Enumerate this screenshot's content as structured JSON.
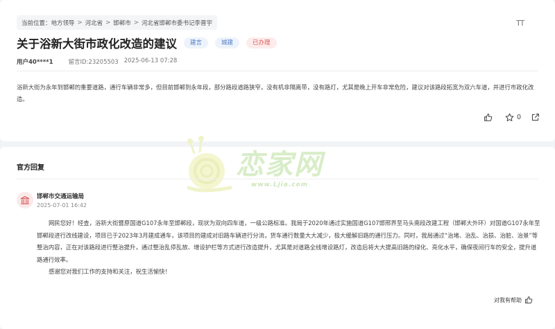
{
  "breadcrumb": {
    "prefix": "当前位置：",
    "items": [
      "地方领导",
      "河北省",
      "邯郸市",
      "河北省邯郸市委书记李晋宇"
    ],
    "separator": ">"
  },
  "font_size_label": "TT",
  "message": {
    "title": "关于浴新大街市政化改造的建议",
    "tags": [
      {
        "label": "建言",
        "color": "#4d7bc4"
      },
      {
        "label": "城建",
        "color": "#4d7bc4"
      },
      {
        "label": "已办理",
        "color": "#e05a5a"
      }
    ],
    "user": "用户40****1",
    "id_text": "留言ID:23205503",
    "datetime": "2025-06-13 07:28",
    "content": "浴新大街为永年到邯郸的重要道路，通行车辆非常多，但目前邯郸到永年段，部分路段道路狭窄，没有机非隔离带，没有路灯，尤其是晚上开车非常危险，建议对该路段拓宽为双六车道，并进行市政化改造。",
    "favorite_count": "0"
  },
  "icons": {
    "like": "thumbs-up-icon",
    "favorite": "star-icon",
    "share": "share-icon",
    "org": "government-building-icon"
  },
  "reply": {
    "section_title": "官方回复",
    "org": "邯郸市交通运输局",
    "datetime": "2025-07-01 16:42",
    "paragraph1": "网民您好！经查，浴新大街暨原国道G107永年至邯郸段，现状为双向四车道，一级公路标准。我局于2020年通过实施国道G107邯邢界至马头南段改建工程（邯郸大外环）对国道G107永年至邯郸段进行改线建设，项目已于2023年3月建成通车，该项目的建成对旧路车辆进行分流，货车通行数量大大减少，极大缓解旧路的通行压力。同时，我局通过“治堵、治乱、治损、治脏、治景”等整治内容，正在对该路段进行整治提升，通过整治乱停乱放、增设护栏等方式进行改造提升，尤其是对道路全线增设路灯，改造后将大大提高旧路的绿化、亮化水平，确保夜间行车的安全，提升道路通行效率。",
    "paragraph2": "感谢您对我们工作的支持和关注，祝生活愉快！",
    "helpful_label": "对我有帮助"
  },
  "watermark": {
    "text": "恋家网",
    "url": "www.Ljia.com"
  },
  "colors": {
    "background": "#f2f3f5",
    "tag_blue_bg": "#eef3fb",
    "tag_red_bg": "#fdecec",
    "watermark_green": "#d8edc8"
  }
}
